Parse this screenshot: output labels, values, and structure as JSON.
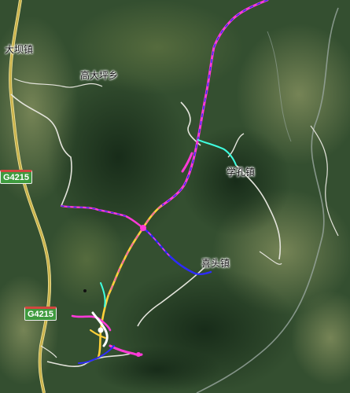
{
  "map": {
    "labels": {
      "dabazhen": "大坝镇",
      "gaodapingxiang": "高大坪乡",
      "xuekongzhen": "学孔镇",
      "xitouzhen": "喜头镇"
    },
    "highway_shields": {
      "north": "G4215",
      "south": "G4215"
    },
    "colors": {
      "highway": "#c9b24a",
      "minor_road": "#e4e4dc",
      "river": "#9aa8a0",
      "track_primary": "#ff3ad8",
      "track_secondary": "#2d2aff",
      "track_tertiary": "#ffd13a",
      "track_accent": "#3fffe0",
      "terrain_dark": "#1f3620",
      "terrain_mid": "#3c5a34",
      "terrain_light": "#6c7d4e"
    }
  }
}
